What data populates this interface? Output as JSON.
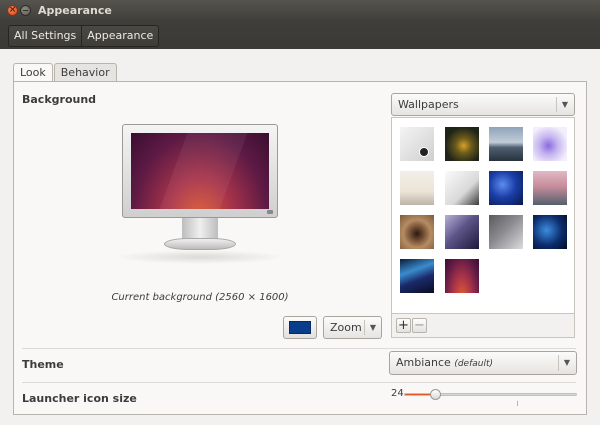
{
  "window": {
    "title": "Appearance"
  },
  "breadcrumbs": [
    "All Settings",
    "Appearance"
  ],
  "tabs": [
    {
      "label": "Look"
    },
    {
      "label": "Behavior"
    }
  ],
  "background": {
    "section_label": "Background",
    "caption": "Current background (2560 × 1600)",
    "color_swatch": "#0a3c8c",
    "zoom_option": "Zoom",
    "source_selected": "Wallpapers",
    "add_symbol": "+",
    "remove_symbol": "−",
    "wallpapers": [
      "wallpaper-1",
      "wallpaper-2",
      "wallpaper-3",
      "wallpaper-4",
      "wallpaper-5",
      "wallpaper-6",
      "wallpaper-7",
      "wallpaper-8",
      "wallpaper-9",
      "wallpaper-10",
      "wallpaper-11",
      "wallpaper-12",
      "wallpaper-13",
      "wallpaper-14"
    ]
  },
  "theme": {
    "label": "Theme",
    "value": "Ambiance",
    "suffix": "(default)"
  },
  "launcher": {
    "label": "Launcher icon size",
    "value": "24",
    "level": 0.18
  },
  "colors": {
    "accent": "#e05a28",
    "titlebar": "#3c3b37"
  }
}
